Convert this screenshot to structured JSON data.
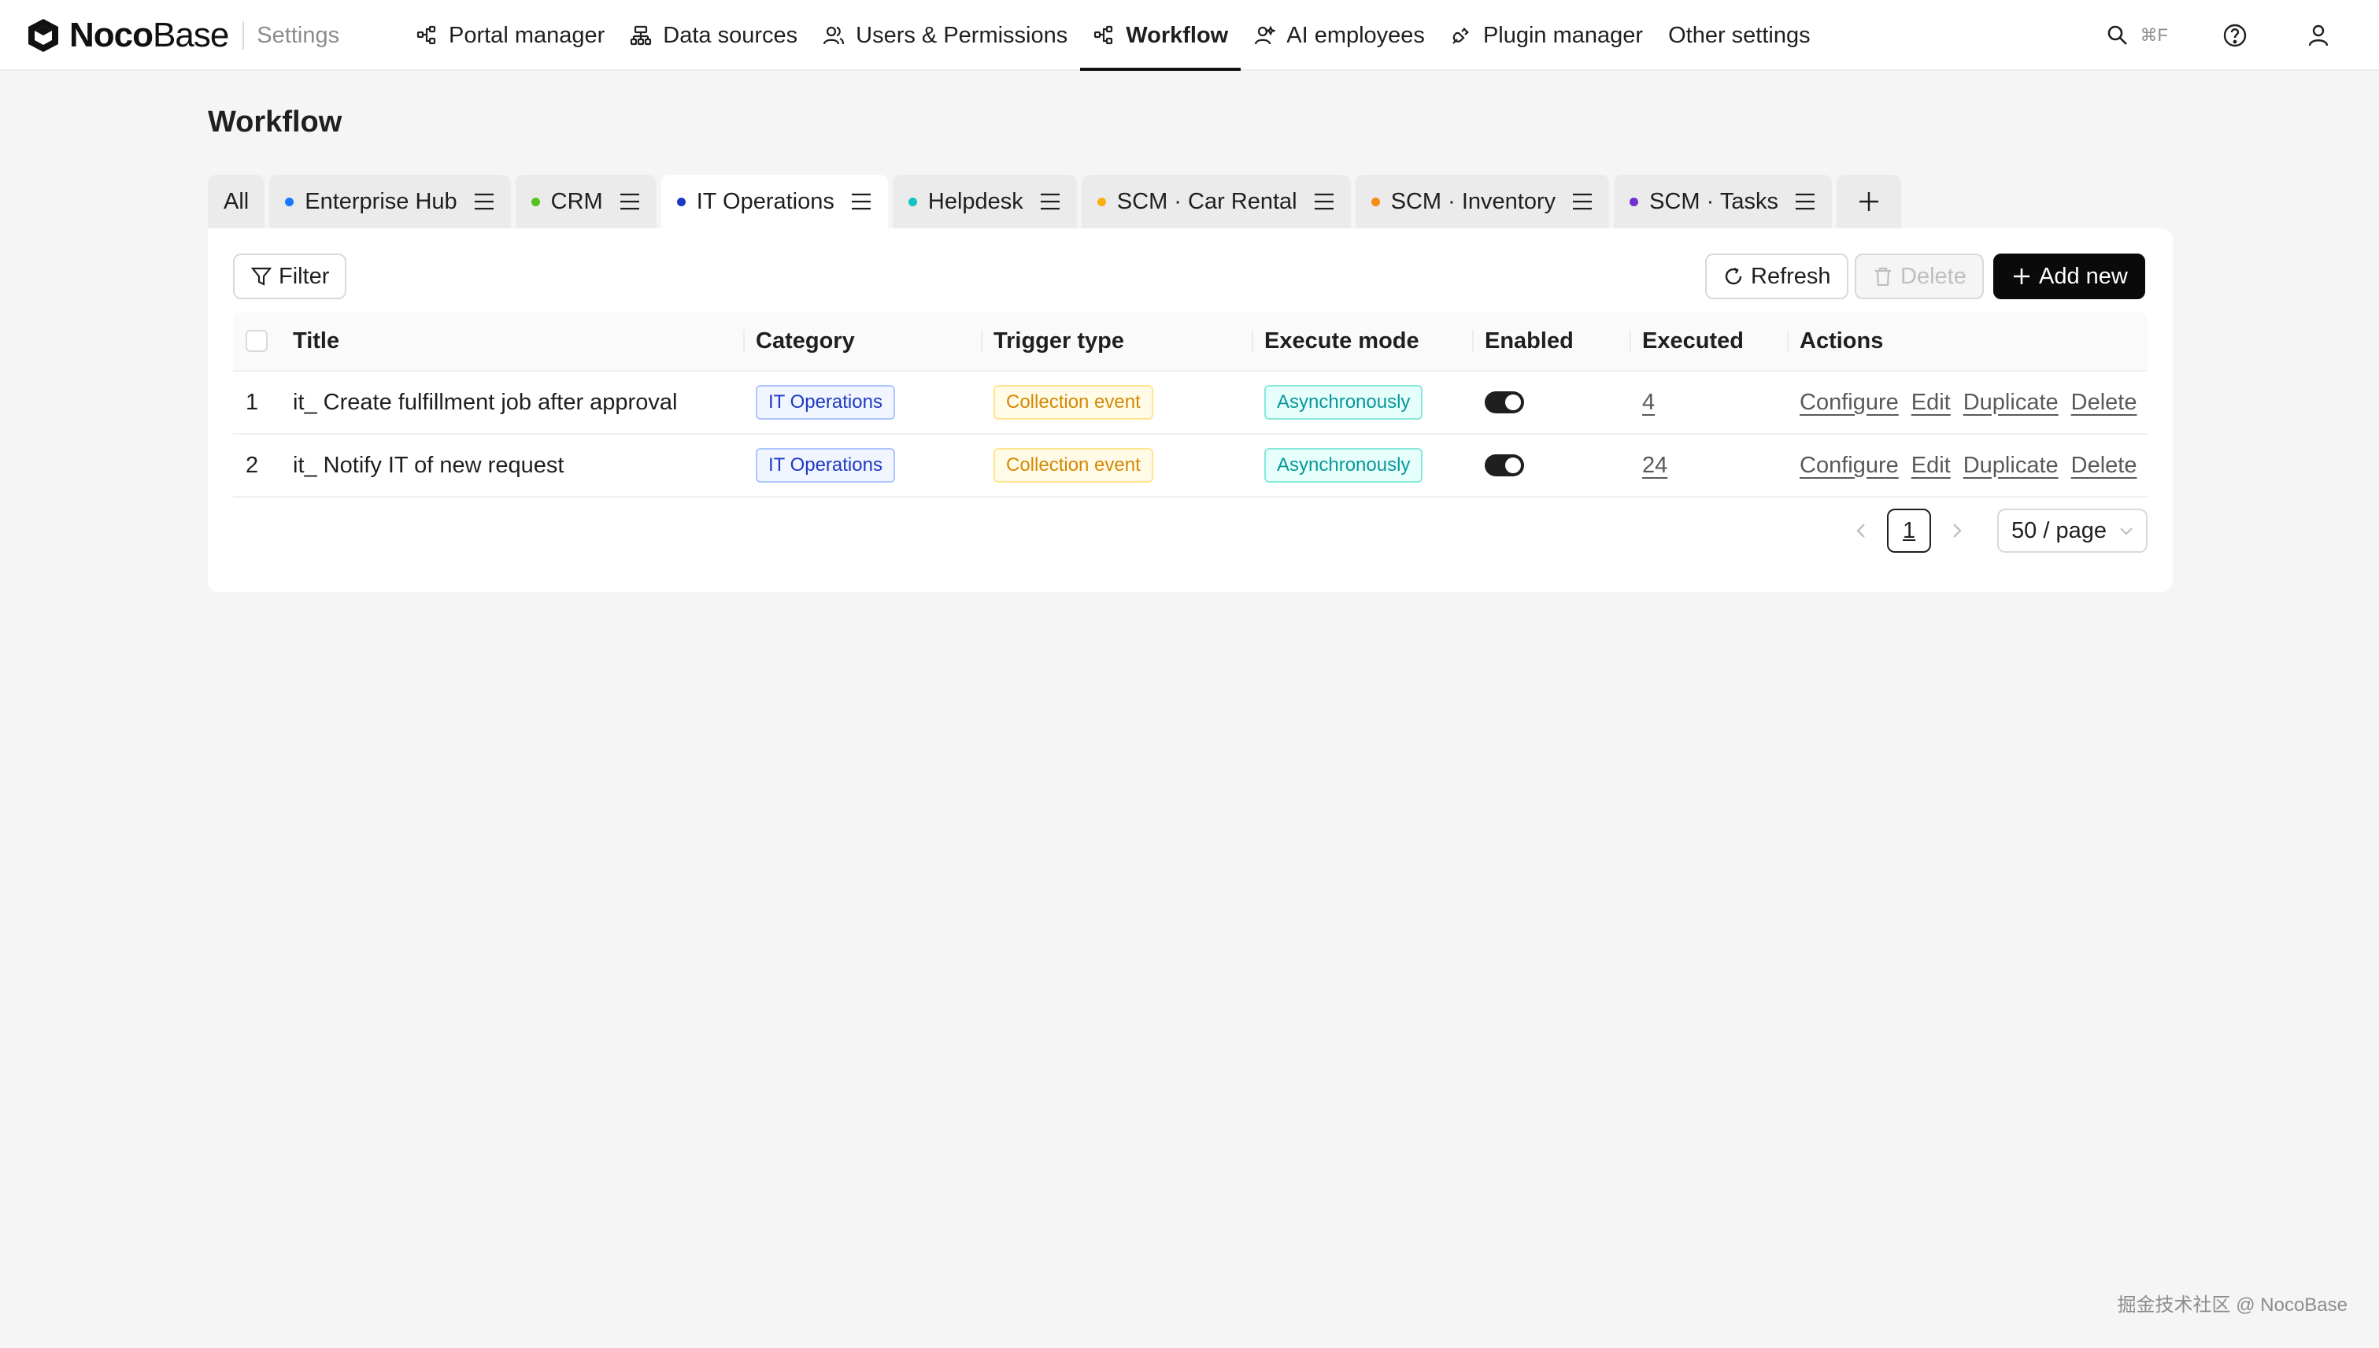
{
  "header": {
    "brand_bold": "Noco",
    "brand_light": "Base",
    "section": "Settings",
    "nav": [
      {
        "label": "Portal manager",
        "icon": "portal-icon"
      },
      {
        "label": "Data sources",
        "icon": "database-icon"
      },
      {
        "label": "Users & Permissions",
        "icon": "users-icon"
      },
      {
        "label": "Workflow",
        "icon": "workflow-icon",
        "active": true
      },
      {
        "label": "AI employees",
        "icon": "ai-employee-icon"
      },
      {
        "label": "Plugin manager",
        "icon": "plugin-icon"
      },
      {
        "label": "Other settings",
        "icon": ""
      }
    ],
    "search_shortcut": "⌘F"
  },
  "page": {
    "title": "Workflow"
  },
  "tabs": [
    {
      "label": "All",
      "dot": ""
    },
    {
      "label": "Enterprise Hub",
      "dot": "#1677ff"
    },
    {
      "label": "CRM",
      "dot": "#52c41a"
    },
    {
      "label": "IT Operations",
      "dot": "#1d39c4",
      "active": true
    },
    {
      "label": "Helpdesk",
      "dot": "#13c2c2"
    },
    {
      "label": "SCM · Car Rental",
      "dot": "#faad14"
    },
    {
      "label": "SCM · Inventory",
      "dot": "#fa8c16"
    },
    {
      "label": "SCM · Tasks",
      "dot": "#722ed1"
    }
  ],
  "toolbar": {
    "filter_label": "Filter",
    "refresh_label": "Refresh",
    "delete_label": "Delete",
    "add_label": "Add new"
  },
  "table": {
    "columns": [
      "Title",
      "Category",
      "Trigger type",
      "Execute mode",
      "Enabled",
      "Executed",
      "Actions"
    ],
    "rows": [
      {
        "index": "1",
        "title": "it_ Create fulfillment job after approval",
        "category": "IT Operations",
        "trigger": "Collection event",
        "mode": "Asynchronously",
        "enabled": true,
        "executed": "4"
      },
      {
        "index": "2",
        "title": "it_ Notify IT of new request",
        "category": "IT Operations",
        "trigger": "Collection event",
        "mode": "Asynchronously",
        "enabled": true,
        "executed": "24"
      }
    ],
    "actions": [
      "Configure",
      "Edit",
      "Duplicate",
      "Delete"
    ]
  },
  "pagination": {
    "current_page": "1",
    "page_size": "50 / page"
  },
  "watermark": "掘金技术社区 @ NocoBase"
}
